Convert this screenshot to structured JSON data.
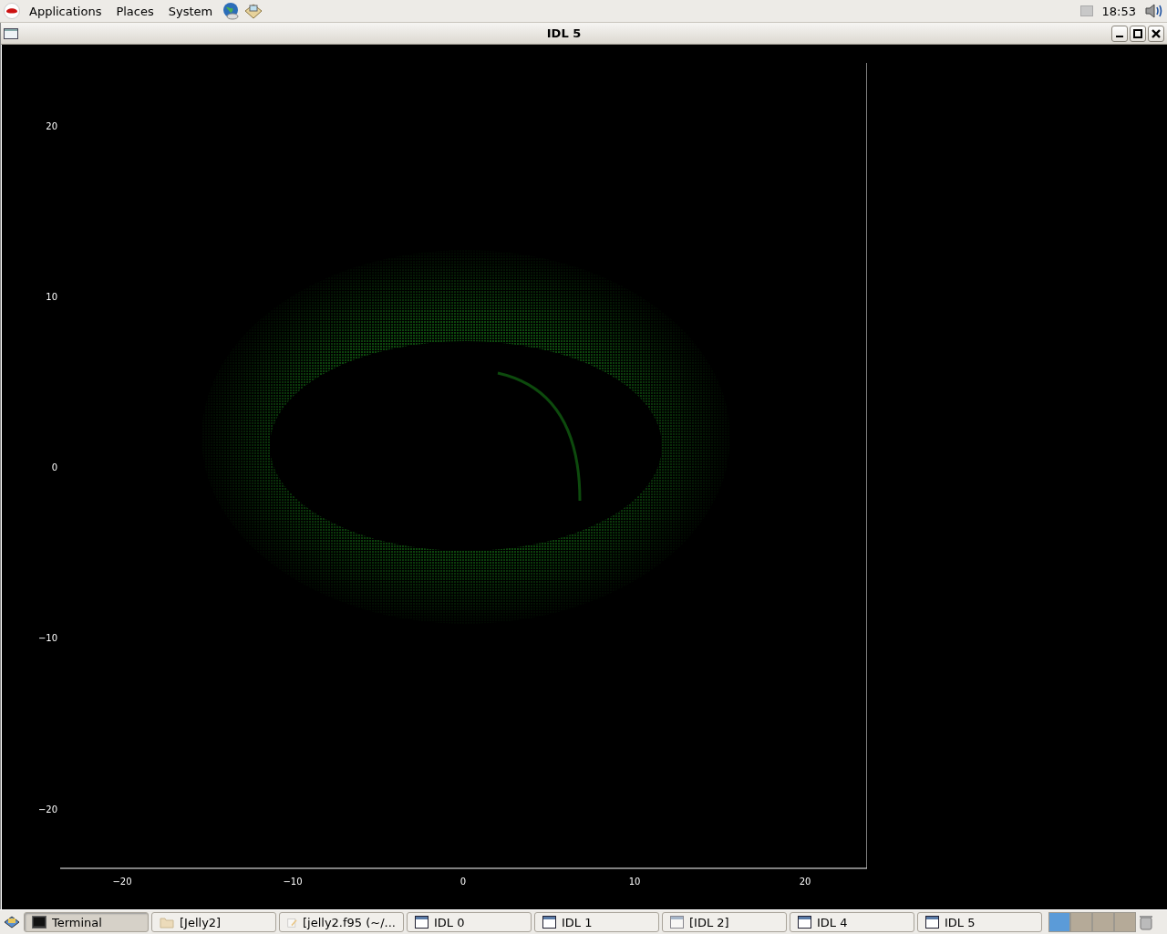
{
  "top_panel": {
    "menus": [
      "Applications",
      "Places",
      "System"
    ],
    "clock": "18:53"
  },
  "window": {
    "title": "IDL 5"
  },
  "plot": {
    "xticks": [
      "−20",
      "−10",
      "0",
      "10",
      "20"
    ],
    "yticks": [
      "20",
      "10",
      "0",
      "−10",
      "−20"
    ]
  },
  "taskbar": {
    "items": [
      {
        "label": "Terminal",
        "kind": "terminal",
        "selected": true,
        "minimized": false
      },
      {
        "label": "[Jelly2]",
        "kind": "folder",
        "selected": false,
        "minimized": true
      },
      {
        "label": "[jelly2.f95 (~/...",
        "kind": "editor",
        "selected": false,
        "minimized": true
      },
      {
        "label": "IDL 0",
        "kind": "window",
        "selected": false,
        "minimized": false
      },
      {
        "label": "IDL 1",
        "kind": "window",
        "selected": false,
        "minimized": false
      },
      {
        "label": "[IDL 2]",
        "kind": "window",
        "selected": false,
        "minimized": true
      },
      {
        "label": "IDL 4",
        "kind": "window",
        "selected": false,
        "minimized": false
      },
      {
        "label": "IDL 5",
        "kind": "window",
        "selected": false,
        "minimized": false
      }
    ],
    "workspaces": [
      {
        "selected": true
      },
      {
        "selected": false
      },
      {
        "selected": false
      },
      {
        "selected": false
      }
    ]
  }
}
